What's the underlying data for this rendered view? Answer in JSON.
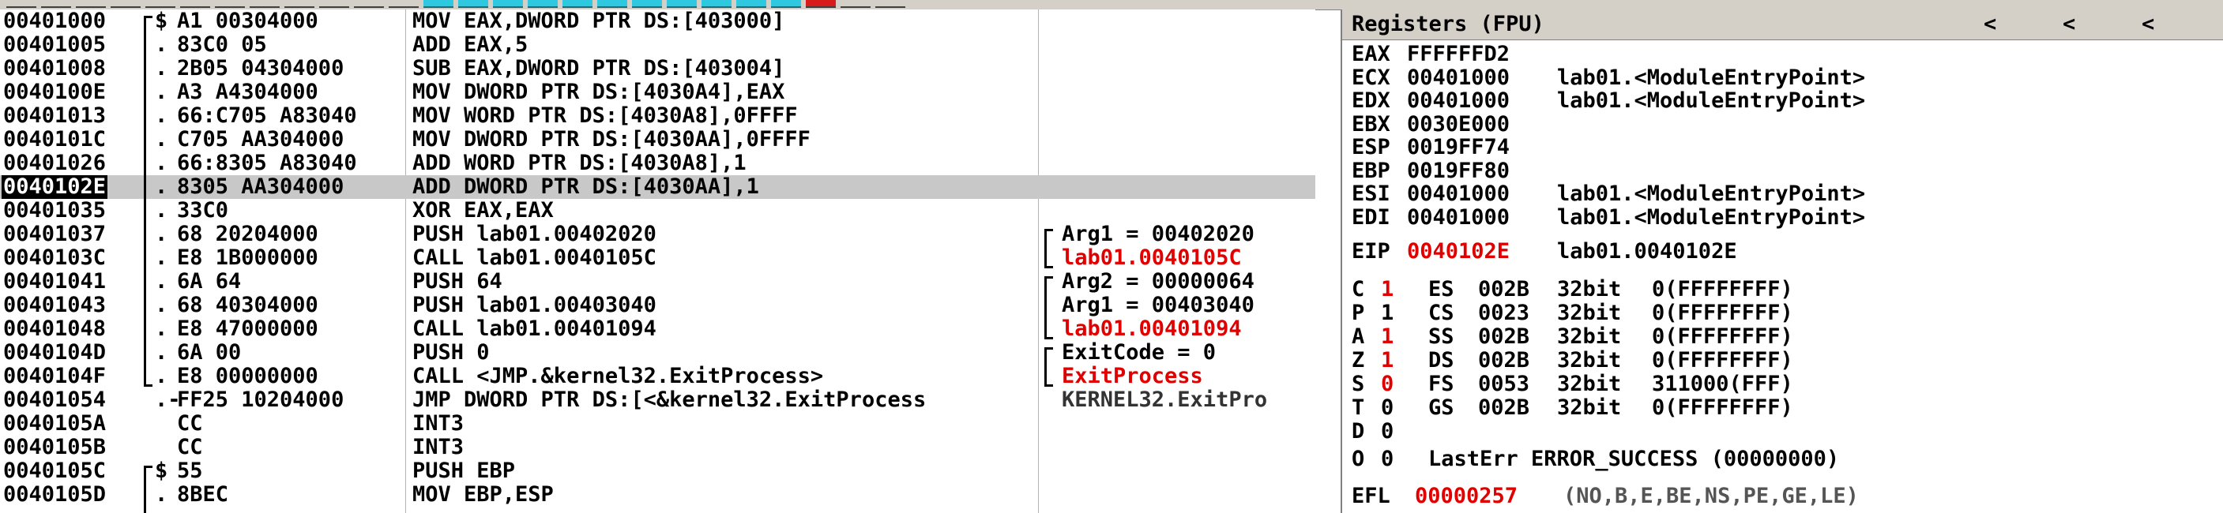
{
  "toolbar": {
    "buttons": [
      "gray",
      "gray",
      "gray",
      "gray",
      "gray",
      "gray",
      "gray",
      "gray",
      "gray",
      "gray",
      "gray",
      "gray",
      "cyan",
      "cyan",
      "cyan",
      "cyan",
      "cyan",
      "cyan",
      "cyan",
      "cyan",
      "cyan",
      "cyan",
      "cyan",
      "red",
      "gray",
      "gray"
    ]
  },
  "disasm": {
    "rows": [
      {
        "addr": "00401000",
        "mark": "$",
        "hex": "A1 00304000",
        "instr": "MOV EAX,DWORD PTR DS:[403000]",
        "comment": "",
        "ccolor": ""
      },
      {
        "addr": "00401005",
        "mark": ".",
        "hex": "83C0 05",
        "instr": "ADD EAX,5",
        "comment": "",
        "ccolor": ""
      },
      {
        "addr": "00401008",
        "mark": ".",
        "hex": "2B05 04304000",
        "instr": "SUB EAX,DWORD PTR DS:[403004]",
        "comment": "",
        "ccolor": ""
      },
      {
        "addr": "0040100E",
        "mark": ".",
        "hex": "A3 A4304000",
        "instr": "MOV DWORD PTR DS:[4030A4],EAX",
        "comment": "",
        "ccolor": ""
      },
      {
        "addr": "00401013",
        "mark": ".",
        "hex": "66:C705 A83040",
        "instr": "MOV WORD PTR DS:[4030A8],0FFFF",
        "comment": "",
        "ccolor": ""
      },
      {
        "addr": "0040101C",
        "mark": ".",
        "hex": "C705 AA304000",
        "instr": "MOV DWORD PTR DS:[4030AA],0FFFF",
        "comment": "",
        "ccolor": ""
      },
      {
        "addr": "00401026",
        "mark": ".",
        "hex": "66:8305 A83040",
        "instr": "ADD WORD PTR DS:[4030A8],1",
        "comment": "",
        "ccolor": ""
      },
      {
        "addr": "0040102E",
        "mark": ".",
        "hex": "8305 AA304000",
        "instr": "ADD DWORD PTR DS:[4030AA],1",
        "comment": "",
        "ccolor": ""
      },
      {
        "addr": "00401035",
        "mark": ".",
        "hex": "33C0",
        "instr": "XOR EAX,EAX",
        "comment": "",
        "ccolor": ""
      },
      {
        "addr": "00401037",
        "mark": ".",
        "hex": "68 20204000",
        "instr": "PUSH lab01.00402020",
        "comment": "Arg1 = 00402020",
        "ccolor": ""
      },
      {
        "addr": "0040103C",
        "mark": ".",
        "hex": "E8 1B000000",
        "instr": "CALL lab01.0040105C",
        "comment": "lab01.0040105C",
        "ccolor": "red"
      },
      {
        "addr": "00401041",
        "mark": ".",
        "hex": "6A 64",
        "instr": "PUSH 64",
        "comment": "Arg2 = 00000064",
        "ccolor": ""
      },
      {
        "addr": "00401043",
        "mark": ".",
        "hex": "68 40304000",
        "instr": "PUSH lab01.00403040",
        "comment": "Arg1 = 00403040",
        "ccolor": ""
      },
      {
        "addr": "00401048",
        "mark": ".",
        "hex": "E8 47000000",
        "instr": "CALL lab01.00401094",
        "comment": "lab01.00401094",
        "ccolor": "red"
      },
      {
        "addr": "0040104D",
        "mark": ".",
        "hex": "6A 00",
        "instr": "PUSH 0",
        "comment": "ExitCode = 0",
        "ccolor": ""
      },
      {
        "addr": "0040104F",
        "mark": ".",
        "hex": "E8 00000000",
        "instr": "CALL <JMP.&kernel32.ExitProcess>",
        "comment": "ExitProcess",
        "ccolor": "red"
      },
      {
        "addr": "00401054",
        "mark": ".-",
        "hex": "FF25 10204000",
        "instr": "JMP DWORD PTR DS:[<&kernel32.ExitProcess",
        "comment": "KERNEL32.ExitPro",
        "ccolor": "gray"
      },
      {
        "addr": "0040105A",
        "mark": "",
        "hex": "CC",
        "instr": "INT3",
        "comment": "",
        "ccolor": ""
      },
      {
        "addr": "0040105B",
        "mark": "",
        "hex": "CC",
        "instr": "INT3",
        "comment": "",
        "ccolor": ""
      },
      {
        "addr": "0040105C",
        "mark": "$",
        "hex": "55",
        "instr": "PUSH EBP",
        "comment": "",
        "ccolor": ""
      },
      {
        "addr": "0040105D",
        "mark": ".",
        "hex": "8BEC",
        "instr": "MOV EBP,ESP",
        "comment": "",
        "ccolor": ""
      }
    ],
    "selected_index": 7
  },
  "registers": {
    "title": "Registers (FPU)",
    "arrows": [
      "<",
      "<",
      "<"
    ],
    "gp": [
      {
        "name": "EAX",
        "value": "FFFFFFD2",
        "note": ""
      },
      {
        "name": "ECX",
        "value": "00401000",
        "note": "lab01.<ModuleEntryPoint>"
      },
      {
        "name": "EDX",
        "value": "00401000",
        "note": "lab01.<ModuleEntryPoint>"
      },
      {
        "name": "EBX",
        "value": "0030E000",
        "note": ""
      },
      {
        "name": "ESP",
        "value": "0019FF74",
        "note": ""
      },
      {
        "name": "EBP",
        "value": "0019FF80",
        "note": ""
      },
      {
        "name": "ESI",
        "value": "00401000",
        "note": "lab01.<ModuleEntryPoint>"
      },
      {
        "name": "EDI",
        "value": "00401000",
        "note": "lab01.<ModuleEntryPoint>"
      }
    ],
    "eip": {
      "name": "EIP",
      "value": "0040102E",
      "note": "lab01.0040102E"
    },
    "flags": [
      {
        "flag": "C",
        "val": "1",
        "red": true,
        "seg": "ES",
        "sel": "002B",
        "bits": "32bit",
        "base": "0(FFFFFFFF)"
      },
      {
        "flag": "P",
        "val": "1",
        "red": false,
        "seg": "CS",
        "sel": "0023",
        "bits": "32bit",
        "base": "0(FFFFFFFF)"
      },
      {
        "flag": "A",
        "val": "1",
        "red": true,
        "seg": "SS",
        "sel": "002B",
        "bits": "32bit",
        "base": "0(FFFFFFFF)"
      },
      {
        "flag": "Z",
        "val": "1",
        "red": true,
        "seg": "DS",
        "sel": "002B",
        "bits": "32bit",
        "base": "0(FFFFFFFF)"
      },
      {
        "flag": "S",
        "val": "0",
        "red": true,
        "seg": "FS",
        "sel": "0053",
        "bits": "32bit",
        "base": "311000(FFF)"
      },
      {
        "flag": "T",
        "val": "0",
        "red": false,
        "seg": "GS",
        "sel": "002B",
        "bits": "32bit",
        "base": "0(FFFFFFFF)"
      },
      {
        "flag": "D",
        "val": "0",
        "red": false,
        "seg": "",
        "sel": "",
        "bits": "",
        "base": ""
      }
    ],
    "o_flag": {
      "flag": "O",
      "val": "0",
      "lasterr": "LastErr ERROR_SUCCESS (00000000)"
    },
    "efl": {
      "name": "EFL",
      "value": "00000257",
      "desc": "(NO,B,E,BE,NS,PE,GE,LE)"
    }
  }
}
